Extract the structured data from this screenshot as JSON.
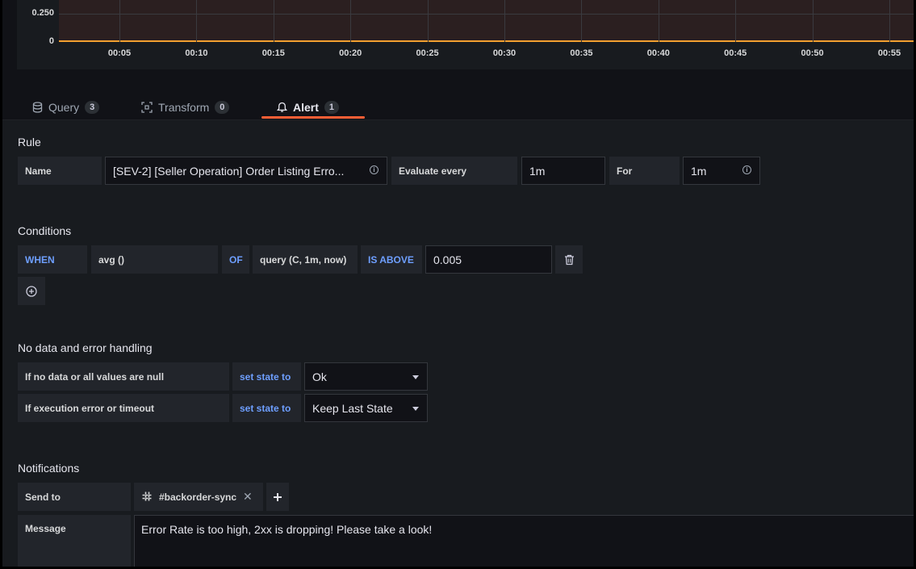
{
  "chart": {
    "y_ticks": [
      "0.250",
      "0"
    ],
    "x_ticks": [
      "00:05",
      "00:10",
      "00:15",
      "00:20",
      "00:25",
      "00:30",
      "00:35",
      "00:40",
      "00:45",
      "00:50",
      "00:55"
    ]
  },
  "tabs": [
    {
      "label": "Query",
      "count": "3",
      "icon": "database-icon"
    },
    {
      "label": "Transform",
      "count": "0",
      "icon": "transform-icon"
    },
    {
      "label": "Alert",
      "count": "1",
      "icon": "bell-icon",
      "active": true
    }
  ],
  "rule": {
    "title": "Rule",
    "name_label": "Name",
    "name_value": "[SEV-2] [Seller Operation] Order Listing Erro...",
    "evaluate_label": "Evaluate every",
    "evaluate_value": "1m",
    "for_label": "For",
    "for_value": "1m"
  },
  "conditions": {
    "title": "Conditions",
    "when": "WHEN",
    "reducer": "avg ()",
    "of": "OF",
    "query": "query (C, 1m, now)",
    "evaluator": "IS ABOVE",
    "threshold": "0.005"
  },
  "nodata": {
    "title": "No data and error handling",
    "rows": [
      {
        "label": "If no data or all values are null",
        "action": "set state to",
        "value": "Ok"
      },
      {
        "label": "If execution error or timeout",
        "action": "set state to",
        "value": "Keep Last State"
      }
    ]
  },
  "notifications": {
    "title": "Notifications",
    "send_to_label": "Send to",
    "channel": "#backorder-sync",
    "message_label": "Message",
    "message": "Error Rate is too high, 2xx is dropping! Please take a look!"
  }
}
